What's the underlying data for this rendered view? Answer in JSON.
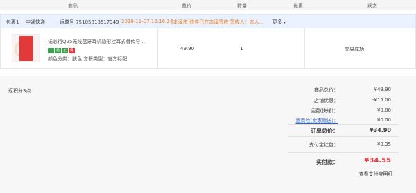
{
  "header": {
    "product": "商品",
    "unit_price": "单价",
    "quantity": "数量",
    "discount": "优惠",
    "status": "状态"
  },
  "package": {
    "label": "包裹1",
    "carrier": "中通快递",
    "tracking": "运单号 75105818517349",
    "time": "2018-11-07 12:16:24",
    "status_text": "[本溪市]快件已在本溪签收 签收人：本人...",
    "more": "更多"
  },
  "item": {
    "title": "诺必行Q25无线蓝牙耳机隐形挂耳式骨传导...",
    "badges": [
      {
        "text": "7",
        "color": "#3aa04a"
      },
      {
        "text": "极",
        "color": "#3aa04a"
      },
      {
        "text": "正",
        "color": "#3aa04a"
      },
      {
        "text": "保",
        "color": "#e4393c"
      }
    ],
    "spec": "颜色分类：肤色  套餐类型：官方标配",
    "price": "49.90",
    "qty": "1",
    "status": "交易成功"
  },
  "summary": {
    "points": "返积分3点",
    "rows": [
      {
        "label": "商品总价：",
        "value": "¥49.90"
      },
      {
        "label": "店铺优惠：",
        "value": "-¥15.00"
      },
      {
        "label": "运费(快递)：",
        "value": "¥0.00"
      },
      {
        "label": "运费险(卖家赠送)：",
        "value": "¥0.00"
      },
      {
        "label": "订单总价：",
        "value": "¥34.90"
      },
      {
        "label": "支付宝红包：",
        "value": "-¥0.35"
      },
      {
        "label": "实付款：",
        "value": "¥34.55"
      }
    ],
    "view_button": "查看支付宝明细"
  }
}
